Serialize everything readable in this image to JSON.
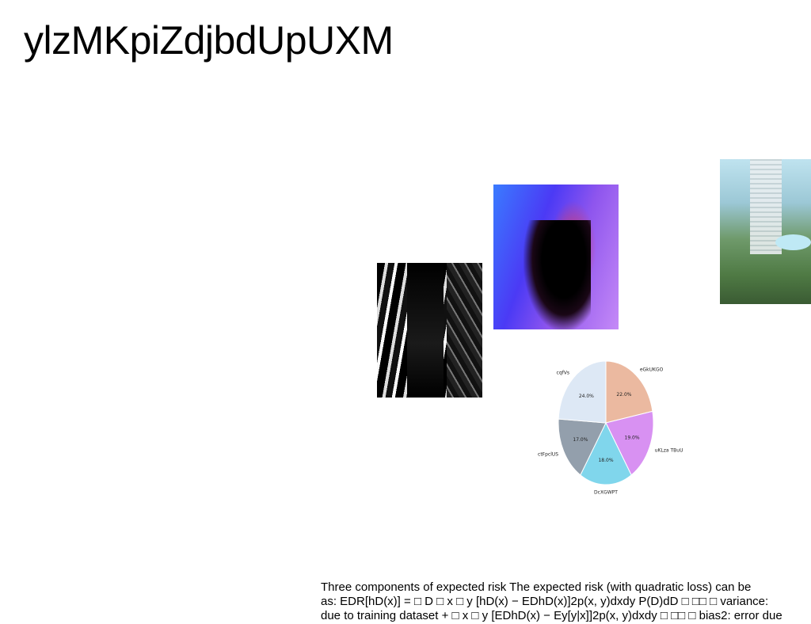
{
  "title": "ylzMKpiZdjbdUpUXM",
  "images": [
    {
      "name": "black-white-building-photo"
    },
    {
      "name": "blue-purple-silhouette-photo"
    },
    {
      "name": "landscape-tower-photo"
    }
  ],
  "chart_data": {
    "type": "pie",
    "title": "",
    "slices": [
      {
        "label": "eGkUKGO",
        "value": 22.0,
        "pct_label": "22.0%",
        "color": "#ebb9a0"
      },
      {
        "label": "uKLza TBuU",
        "value": 19.0,
        "pct_label": "19.0%",
        "color": "#d891f2"
      },
      {
        "label": "DcXGWPT",
        "value": 18.0,
        "pct_label": "18.0%",
        "color": "#80d6ec"
      },
      {
        "label": "ctFpclUS",
        "value": 17.0,
        "pct_label": "17.0%",
        "color": "#939fac"
      },
      {
        "label": "cqfVs",
        "value": 24.0,
        "pct_label": "24.0%",
        "color": "#dde8f5"
      }
    ],
    "start_angle_deg": 90,
    "direction": "clockwise"
  },
  "caption": {
    "lines": [
      "Three components of expected risk The expected risk (with quadratic loss) can be",
      "as: EDR[hD(x)] = □ D □ x □ y [hD(x) − EDhD(x)]2p(x, y)dxdy P(D)dD □ □□ □ variance:",
      "due to training dataset + □ x □ y [EDhD(x) − Ey[y|x]]2p(x, y)dxdy □ □□ □ bias2: error due"
    ]
  }
}
